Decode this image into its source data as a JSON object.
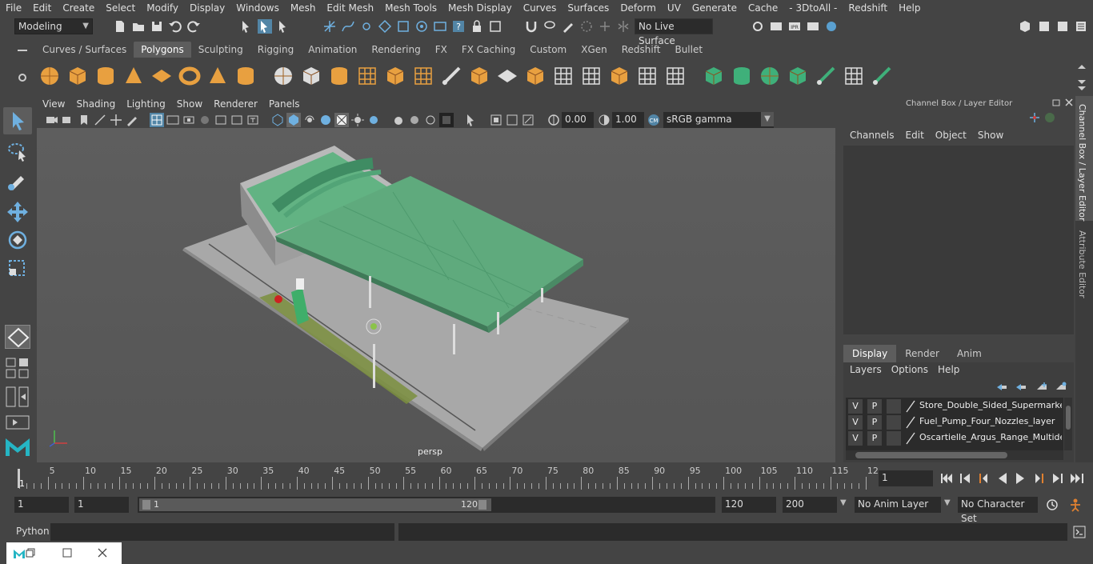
{
  "menubar": [
    "File",
    "Edit",
    "Create",
    "Select",
    "Modify",
    "Display",
    "Windows",
    "Mesh",
    "Edit Mesh",
    "Mesh Tools",
    "Mesh Display",
    "Curves",
    "Surfaces",
    "Deform",
    "UV",
    "Generate",
    "Cache",
    "- 3DtoAll -",
    "Redshift",
    "Help"
  ],
  "status": {
    "mode": "Modeling",
    "live_surface": "No Live Surface"
  },
  "shelf_tabs": [
    "Curves / Surfaces",
    "Polygons",
    "Sculpting",
    "Rigging",
    "Animation",
    "Rendering",
    "FX",
    "FX Caching",
    "Custom",
    "XGen",
    "Redshift",
    "Bullet"
  ],
  "shelf_active": "Polygons",
  "viewport": {
    "menu": [
      "View",
      "Shading",
      "Lighting",
      "Show",
      "Renderer",
      "Panels"
    ],
    "exposure": "0.00",
    "gamma": "1.00",
    "colorspace": "sRGB gamma",
    "camera": "persp"
  },
  "channel_box": {
    "title": "Channel Box / Layer Editor",
    "menu": [
      "Channels",
      "Edit",
      "Object",
      "Show"
    ]
  },
  "layer_editor": {
    "tabs": [
      "Display",
      "Render",
      "Anim"
    ],
    "active_tab": "Display",
    "menu": [
      "Layers",
      "Options",
      "Help"
    ],
    "layers": [
      {
        "v": "V",
        "p": "P",
        "name": "Store_Double_Sided_Supermarket_"
      },
      {
        "v": "V",
        "p": "P",
        "name": "Fuel_Pump_Four_Nozzles_layer"
      },
      {
        "v": "V",
        "p": "P",
        "name": "Oscartielle_Argus_Range_Multidec"
      }
    ]
  },
  "side_tabs": [
    "Channel Box / Layer Editor",
    "Attribute Editor"
  ],
  "timeline": {
    "ticks": [
      "5",
      "10",
      "15",
      "20",
      "25",
      "30",
      "35",
      "40",
      "45",
      "50",
      "55",
      "60",
      "65",
      "70",
      "75",
      "80",
      "85",
      "90",
      "95",
      "100",
      "105",
      "110",
      "115",
      "12"
    ],
    "start_marker": "1",
    "current_frame": "1"
  },
  "range": {
    "start": "1",
    "playback_start": "1",
    "slider_start": "1",
    "slider_end": "120",
    "playback_end": "120",
    "end": "200",
    "anim_layer": "No Anim Layer",
    "character_set": "No Character Set"
  },
  "command": {
    "label": "Python"
  },
  "colors": {
    "bg": "#444444",
    "field": "#2b2b2b",
    "accent": "#5285a6",
    "canopy": "#5faa7d"
  }
}
